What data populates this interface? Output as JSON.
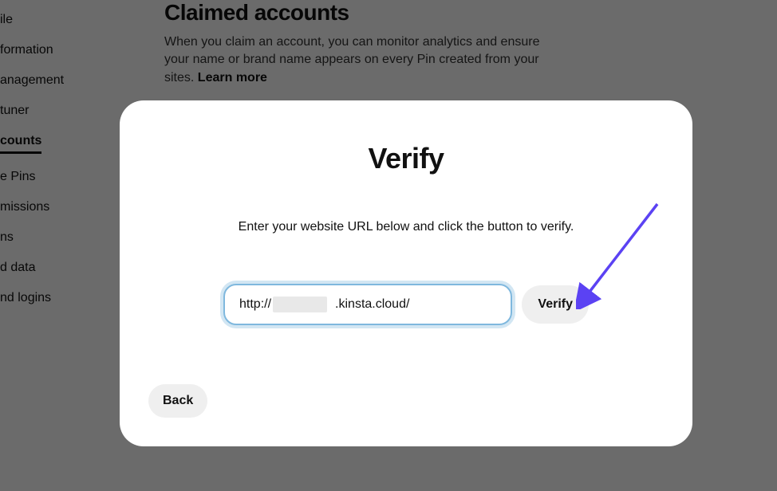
{
  "sidebar": {
    "items": [
      {
        "label": "ile"
      },
      {
        "label": "formation"
      },
      {
        "label": "anagement"
      },
      {
        "label": " tuner"
      },
      {
        "label": "counts",
        "active": true
      },
      {
        "label": "e Pins"
      },
      {
        "label": "missions"
      },
      {
        "label": "ns"
      },
      {
        "label": "d data"
      },
      {
        "label": "nd logins"
      }
    ]
  },
  "page": {
    "title": "Claimed accounts",
    "desc_before": "When you claim an account, you can monitor analytics and ensure your name or brand name appears on every Pin created from your sites. ",
    "learn_more": "Learn more"
  },
  "modal": {
    "title": "Verify",
    "desc": "Enter your website URL below and click the button to verify.",
    "url_value": "http://                  .kinsta.cloud/",
    "verify_label": "Verify",
    "back_label": "Back"
  },
  "annotation": {
    "arrow_color": "#5b42f3"
  }
}
